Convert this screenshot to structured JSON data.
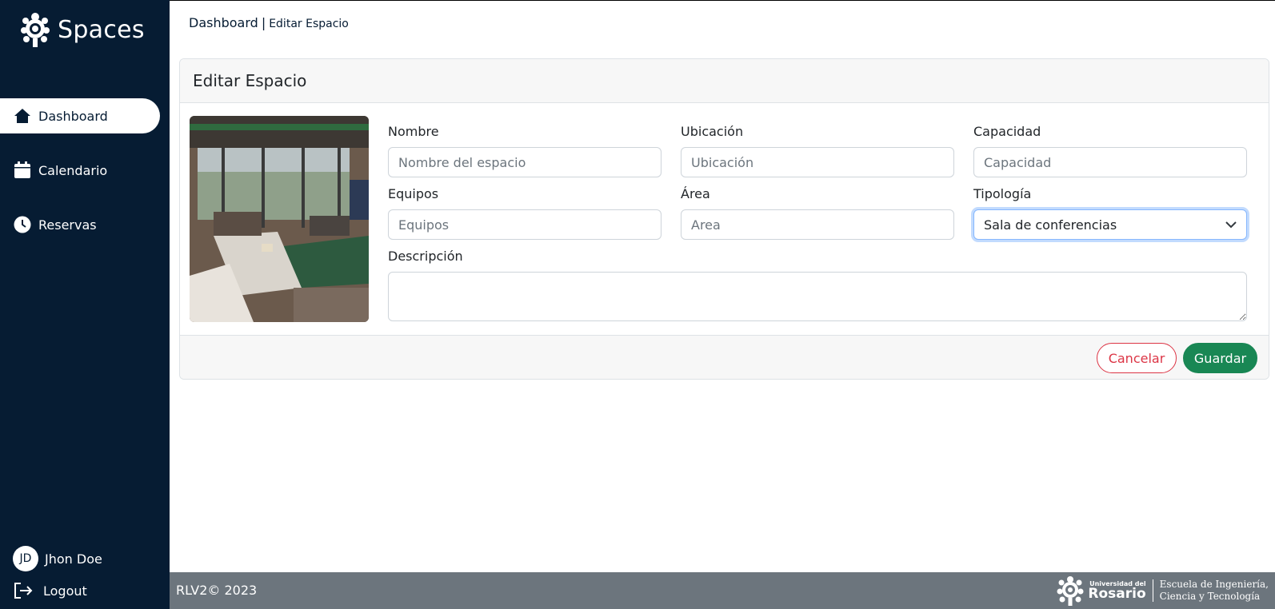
{
  "sidebar": {
    "brand": "Spaces",
    "nav": [
      {
        "label": "Dashboard",
        "icon": "home-icon",
        "active": true
      },
      {
        "label": "Calendario",
        "icon": "calendar-icon",
        "active": false
      },
      {
        "label": "Reservas",
        "icon": "clock-icon",
        "active": false
      }
    ],
    "user": {
      "initials": "JD",
      "name": "Jhon Doe"
    },
    "logout_label": "Logout"
  },
  "breadcrumb": {
    "main": "Dashboard",
    "separator": "|",
    "current": "Editar Espacio"
  },
  "card": {
    "title": "Editar Espacio",
    "fields": {
      "nombre": {
        "label": "Nombre",
        "placeholder": "Nombre del espacio",
        "value": ""
      },
      "ubicacion": {
        "label": "Ubicación",
        "placeholder": "Ubicación",
        "value": ""
      },
      "capacidad": {
        "label": "Capacidad",
        "placeholder": "Capacidad",
        "value": ""
      },
      "equipos": {
        "label": "Equipos",
        "placeholder": "Equipos",
        "value": ""
      },
      "area": {
        "label": "Área",
        "placeholder": "Area",
        "value": ""
      },
      "tipologia": {
        "label": "Tipología",
        "selected": "Sala de conferencias"
      },
      "descripcion": {
        "label": "Descripción",
        "value": ""
      }
    },
    "buttons": {
      "cancel": "Cancelar",
      "save": "Guardar"
    }
  },
  "footer": {
    "copyright": "RLV2© 2023",
    "logo": {
      "small": "Universidad del",
      "big": "Rosario",
      "school_line1": "Escuela de Ingeniería,",
      "school_line2": "Ciencia y Tecnología"
    }
  },
  "colors": {
    "sidebar": "#061c33",
    "footer": "#6c757d",
    "save": "#198754",
    "cancel": "#dc3545"
  }
}
